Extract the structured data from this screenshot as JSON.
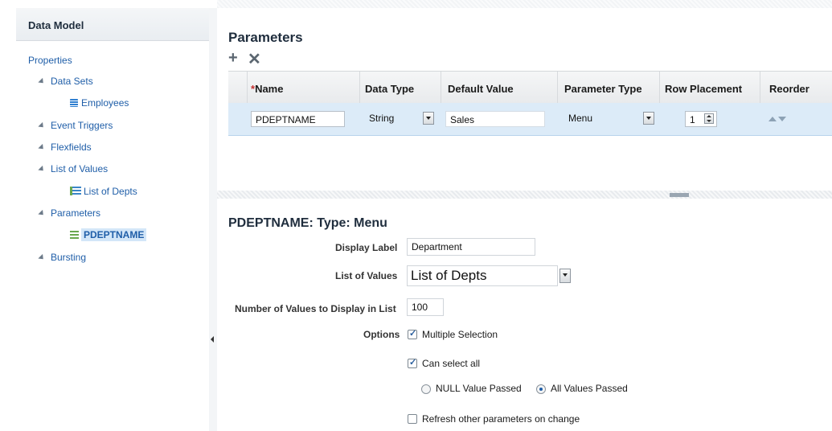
{
  "left_panel": {
    "title": "Data Model",
    "tree": {
      "properties": "Properties",
      "data_sets": "Data Sets",
      "employees": "Employees",
      "event_triggers": "Event Triggers",
      "flexfields": "Flexfields",
      "list_of_values": "List of Values",
      "list_of_depts": "List of Depts",
      "parameters": "Parameters",
      "pdeptname": "PDEPTNAME",
      "bursting": "Bursting"
    }
  },
  "parameters_table": {
    "title": "Parameters",
    "toolbar": {
      "add_icon": "plus-icon",
      "delete_icon": "x-icon"
    },
    "columns": {
      "required_marker": "*",
      "name": "Name",
      "data_type": "Data Type",
      "default_value": "Default Value",
      "parameter_type": "Parameter Type",
      "row_placement": "Row Placement",
      "reorder": "Reorder"
    },
    "row": {
      "name": "PDEPTNAME",
      "data_type": "String",
      "default_value": "Sales",
      "parameter_type": "Menu",
      "row_placement": "1"
    }
  },
  "detail": {
    "title": "PDEPTNAME: Type: Menu",
    "display_label": {
      "label": "Display Label",
      "value": "Department"
    },
    "list_of_values": {
      "label": "List of Values",
      "value": "List of Depts"
    },
    "num_values": {
      "label": "Number of Values to Display in List",
      "value": "100"
    },
    "options": {
      "label": "Options",
      "multiple_selection": {
        "label": "Multiple Selection",
        "checked": true
      },
      "can_select_all": {
        "label": "Can select all",
        "checked": true
      },
      "null_value_passed": {
        "label": "NULL Value Passed",
        "selected": false
      },
      "all_values_passed": {
        "label": "All Values Passed",
        "selected": true
      },
      "refresh_other": {
        "label": "Refresh other parameters on change",
        "checked": false
      }
    }
  },
  "colors": {
    "link": "#1f5ea8",
    "selected_row": "#dcebf8",
    "selected_node": "#d3e6f8"
  }
}
